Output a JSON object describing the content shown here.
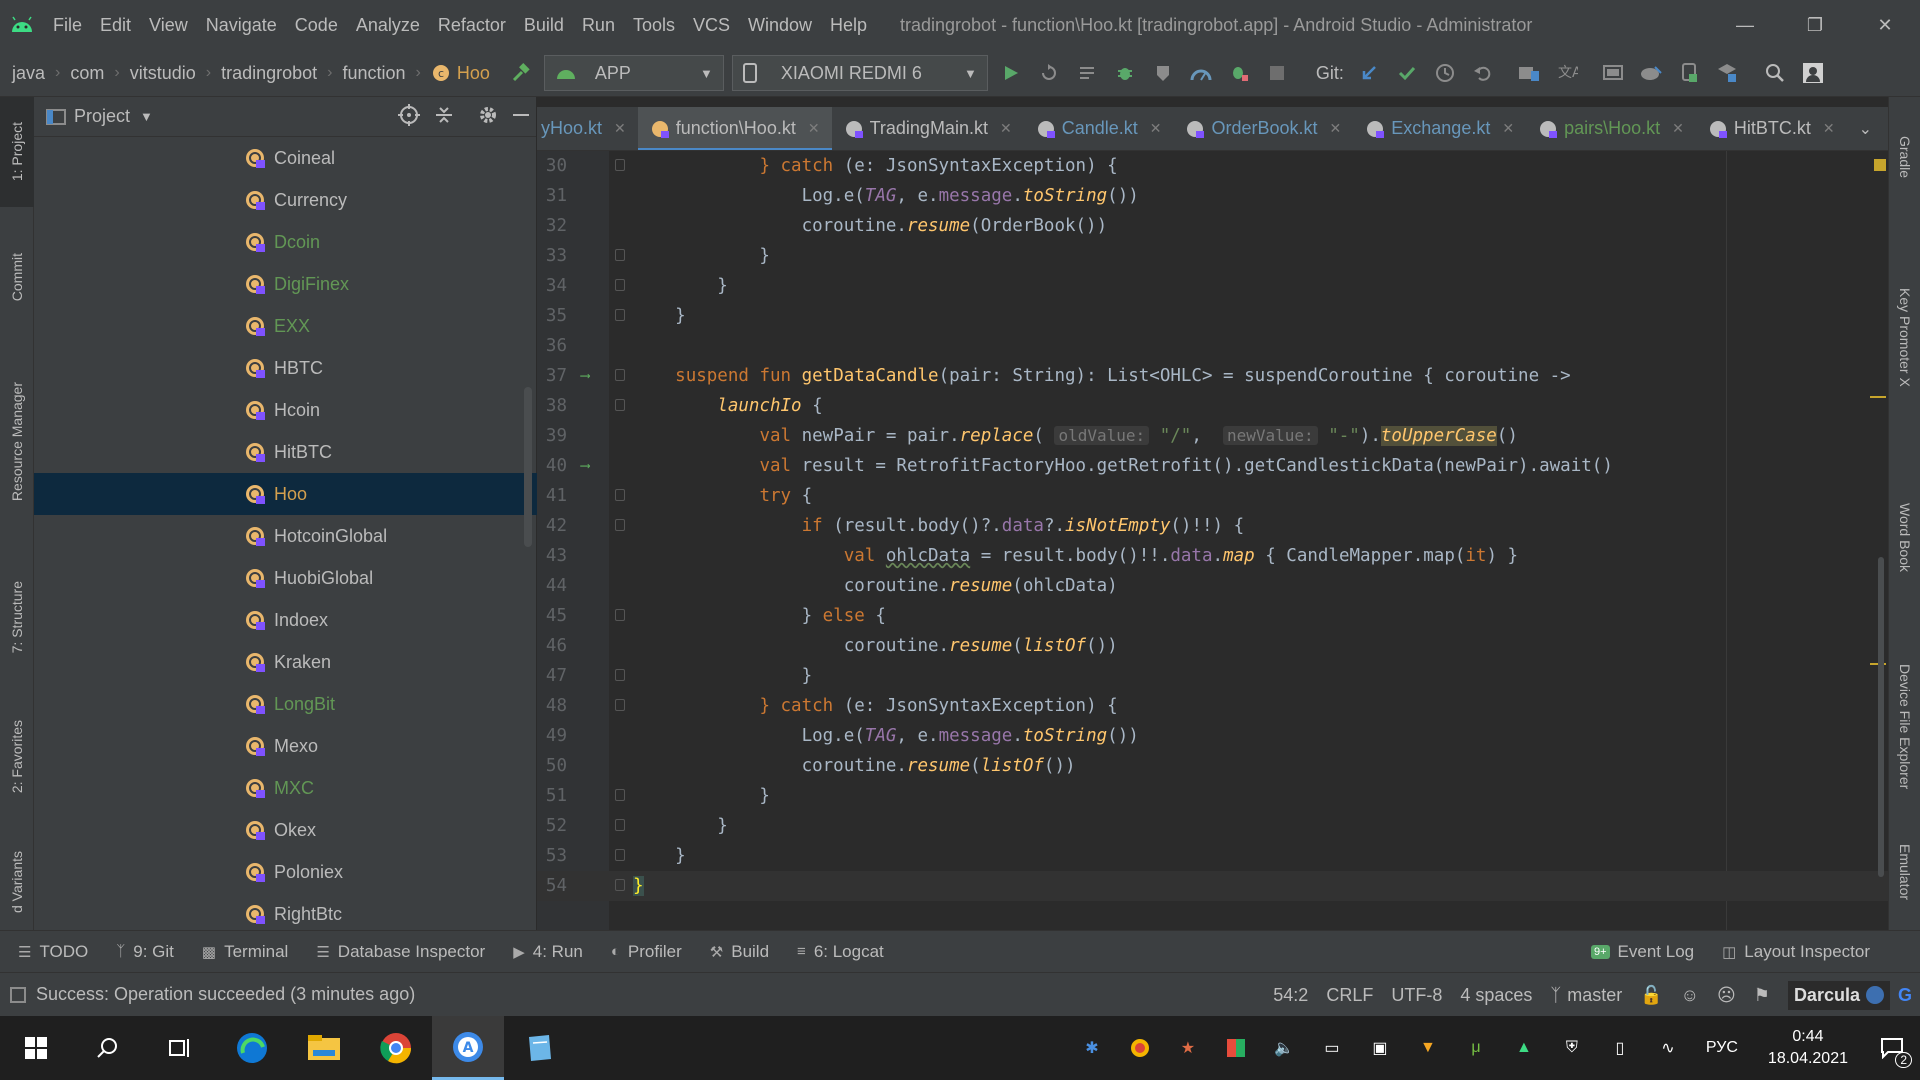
{
  "window": {
    "title": "tradingrobot - function\\Hoo.kt [tradingrobot.app] - Android Studio - Administrator",
    "menu": [
      "File",
      "Edit",
      "View",
      "Navigate",
      "Code",
      "Analyze",
      "Refactor",
      "Build",
      "Run",
      "Tools",
      "VCS",
      "Window",
      "Help"
    ]
  },
  "breadcrumbs": [
    "java",
    "com",
    "vitstudio",
    "tradingrobot",
    "function",
    "Hoo"
  ],
  "toolbar": {
    "run_config": "APP",
    "device": "XIAOMI REDMI 6",
    "git_label": "Git:"
  },
  "left_strip": {
    "project": "1: Project",
    "commit": "Commit",
    "resource_manager": "Resource Manager",
    "structure": "7: Structure",
    "favorites": "2: Favorites",
    "build_variants": "d Variants"
  },
  "project_panel": {
    "title": "Project",
    "items": [
      {
        "label": "Coineal",
        "color": "#bbbbbb"
      },
      {
        "label": "Currency",
        "color": "#bbbbbb"
      },
      {
        "label": "Dcoin",
        "color": "#629755"
      },
      {
        "label": "DigiFinex",
        "color": "#629755"
      },
      {
        "label": "EXX",
        "color": "#629755"
      },
      {
        "label": "HBTC",
        "color": "#bbbbbb"
      },
      {
        "label": "Hcoin",
        "color": "#bbbbbb"
      },
      {
        "label": "HitBTC",
        "color": "#bbbbbb"
      },
      {
        "label": "Hoo",
        "color": "#d4a04e"
      },
      {
        "label": "HotcoinGlobal",
        "color": "#bbbbbb"
      },
      {
        "label": "HuobiGlobal",
        "color": "#bbbbbb"
      },
      {
        "label": "Indoex",
        "color": "#bbbbbb"
      },
      {
        "label": "Kraken",
        "color": "#bbbbbb"
      },
      {
        "label": "LongBit",
        "color": "#629755"
      },
      {
        "label": "Mexo",
        "color": "#bbbbbb"
      },
      {
        "label": "MXC",
        "color": "#629755"
      },
      {
        "label": "Okex",
        "color": "#bbbbbb"
      },
      {
        "label": "Poloniex",
        "color": "#bbbbbb"
      },
      {
        "label": "RightBtc",
        "color": "#bbbbbb"
      }
    ],
    "selected": "Hoo"
  },
  "tabs": [
    {
      "label": "yHoo.kt",
      "state": "modified"
    },
    {
      "label": "function\\Hoo.kt",
      "state": "active"
    },
    {
      "label": "TradingMain.kt",
      "state": "normal"
    },
    {
      "label": "Candle.kt",
      "state": "modified"
    },
    {
      "label": "OrderBook.kt",
      "state": "modified"
    },
    {
      "label": "Exchange.kt",
      "state": "modified"
    },
    {
      "label": "pairs\\Hoo.kt",
      "state": "new"
    },
    {
      "label": "HitBTC.kt",
      "state": "normal"
    }
  ],
  "editor": {
    "line_numbers": [
      "30",
      "31",
      "32",
      "33",
      "34",
      "35",
      "36",
      "37",
      "38",
      "39",
      "40",
      "41",
      "42",
      "43",
      "44",
      "45",
      "46",
      "47",
      "48",
      "49",
      "50",
      "51",
      "52",
      "53",
      "54"
    ],
    "hint_old": "oldValue:",
    "hint_new": "newValue:",
    "ctor": {
      "kw": "catch",
      "e": "(e: ",
      "type": "JsonSyntaxException",
      "close": ") {"
    }
  },
  "right_strip": {
    "gradle": "Gradle",
    "key_promoter": "Key Promoter X",
    "word_book": "Word Book",
    "device_file_explorer": "Device File Explorer",
    "emulator": "Emulator"
  },
  "bottom_tools": [
    {
      "label": "TODO",
      "icon": "list-icon"
    },
    {
      "label": "9: Git",
      "icon": "git-branch-icon"
    },
    {
      "label": "Terminal",
      "icon": "terminal-icon"
    },
    {
      "label": "Database Inspector",
      "icon": "database-icon"
    },
    {
      "label": "4: Run",
      "icon": "play-icon"
    },
    {
      "label": "Profiler",
      "icon": "gauge-icon"
    },
    {
      "label": "Build",
      "icon": "hammer-icon"
    },
    {
      "label": "6: Logcat",
      "icon": "logcat-icon"
    }
  ],
  "bottom_right_tools": [
    {
      "label": "Event Log",
      "badge": "9+"
    },
    {
      "label": "Layout Inspector"
    }
  ],
  "status": {
    "message": "Success: Operation succeeded (3 minutes ago)",
    "position": "54:2",
    "line_sep": "CRLF",
    "encoding": "UTF-8",
    "indent": "4 spaces",
    "branch": "master",
    "theme": "Darcula"
  },
  "taskbar": {
    "language": "РУС",
    "time": "0:44",
    "date": "18.04.2021",
    "notifications": "2"
  }
}
